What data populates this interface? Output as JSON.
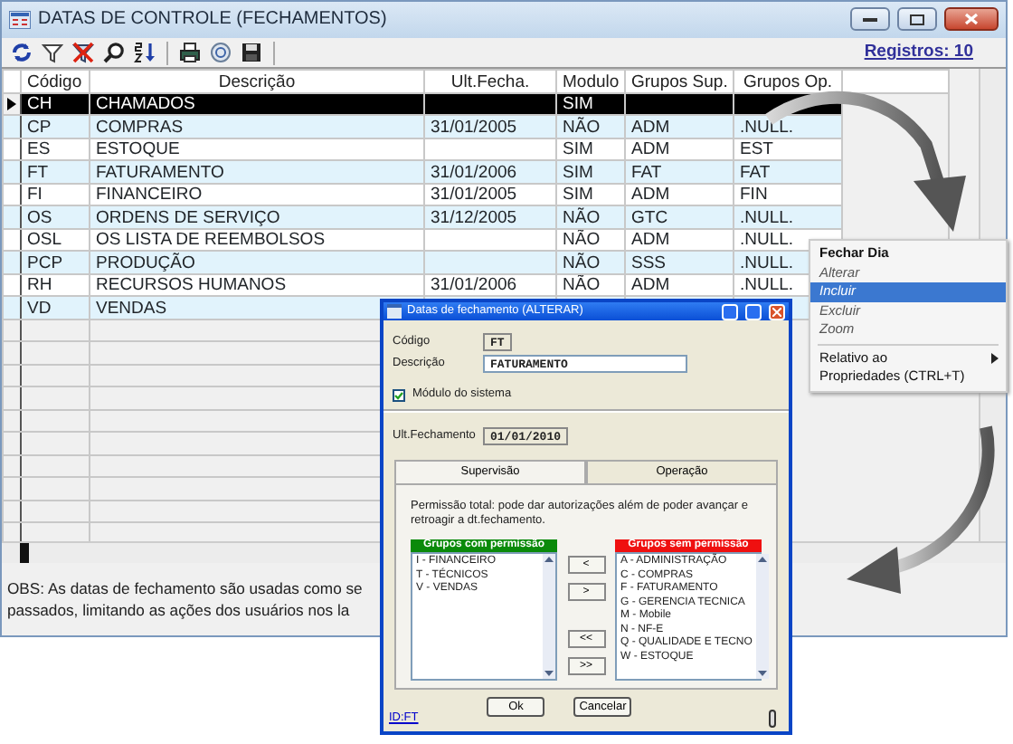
{
  "window": {
    "title": "DATAS DE CONTROLE (FECHAMENTOS)",
    "records": "Registros: 10"
  },
  "table": {
    "columns": [
      "Código",
      "Descrição",
      "Ult.Fecha.",
      "Modulo",
      "Grupos Sup.",
      "Grupos Op."
    ],
    "rows": [
      {
        "cells": [
          "CH",
          "CHAMADOS",
          null,
          "SIM",
          null,
          null
        ],
        "selected": true
      },
      {
        "cells": [
          "CP",
          "COMPRAS",
          "31/01/2005",
          "NÃO",
          "ADM",
          ".NULL."
        ],
        "selected": false
      },
      {
        "cells": [
          "ES",
          "ESTOQUE",
          null,
          "SIM",
          "ADM",
          "EST"
        ],
        "selected": false
      },
      {
        "cells": [
          "FT",
          "FATURAMENTO",
          "31/01/2006",
          "SIM",
          "FAT",
          "FAT"
        ],
        "selected": false
      },
      {
        "cells": [
          "FI",
          "FINANCEIRO",
          "31/01/2005",
          "SIM",
          "ADM",
          "FIN"
        ],
        "selected": false
      },
      {
        "cells": [
          "OS",
          "ORDENS DE SERVIÇO",
          "31/12/2005",
          "NÃO",
          "GTC",
          ".NULL."
        ],
        "selected": false
      },
      {
        "cells": [
          "OSL",
          "OS LISTA DE REEMBOLSOS",
          null,
          "NÃO",
          "ADM",
          ".NULL."
        ],
        "selected": false
      },
      {
        "cells": [
          "PCP",
          "PRODUÇÃO",
          null,
          "NÃO",
          "SSS",
          ".NULL."
        ],
        "selected": false
      },
      {
        "cells": [
          "RH",
          "RECURSOS HUMANOS",
          "31/01/2006",
          "NÃO",
          "ADM",
          ".NULL."
        ],
        "selected": false
      },
      {
        "cells": [
          "VD",
          "VENDAS",
          null,
          null,
          null,
          null
        ],
        "selected": false
      }
    ]
  },
  "note": [
    "OBS: As datas de fechamento são usadas como se",
    "passados, limitando as ações dos usuários nos la"
  ],
  "context_menu": {
    "items": [
      {
        "kind": "item",
        "label": "Fechar Dia",
        "default": true,
        "disabled": false,
        "selected": false
      },
      {
        "kind": "item",
        "label": "Alterar",
        "default": false,
        "disabled": true,
        "selected": false
      },
      {
        "kind": "item",
        "label": "Incluir",
        "default": false,
        "disabled": true,
        "selected": true
      },
      {
        "kind": "item",
        "label": "Excluir",
        "default": false,
        "disabled": true,
        "selected": false
      },
      {
        "kind": "item",
        "label": "Zoom",
        "default": false,
        "disabled": true,
        "selected": false
      },
      {
        "kind": "separator"
      },
      {
        "kind": "submenu",
        "label": "Relativo ao",
        "default": false,
        "disabled": false,
        "selected": false
      },
      {
        "kind": "item",
        "label": "Propriedades (CTRL+T)",
        "default": false,
        "disabled": false,
        "selected": false
      }
    ]
  },
  "dialog": {
    "title": "Datas de fechamento (ALTERAR)",
    "codigo_label": "Código",
    "codigo": "FT",
    "descricao_label": "Descrição",
    "descricao": "FATURAMENTO",
    "module_checkbox": {
      "label": "Módulo do sistema",
      "checked": true
    },
    "ult_label": "Ult.Fechamento",
    "ult": "01/01/2010",
    "tabs": [
      {
        "label": "Supervisão",
        "selected": true
      },
      {
        "label": "Operação",
        "selected": false
      }
    ],
    "permission_text": "Permissão total: pode dar autorizações além de poder avançar e retroagir a dt.fechamento.",
    "with_header": "Grupos com permissão",
    "with_items": [
      "I - FINANCEIRO",
      "T - TÉCNICOS",
      "V - VENDAS"
    ],
    "without_header": "Grupos sem permissão",
    "without_items": [
      "A - ADMINISTRAÇÃO",
      "C - COMPRAS",
      "F - FATURAMENTO",
      "G - GERENCIA TECNICA",
      "M - Mobile",
      "N - NF-E",
      "Q - QUALIDADE E TECNO",
      "W - ESTOQUE"
    ],
    "move_buttons": [
      "<",
      ">",
      "<<",
      ">>"
    ],
    "buttons": [
      "Ok",
      "Cancelar"
    ],
    "id_link": "ID:FT"
  }
}
